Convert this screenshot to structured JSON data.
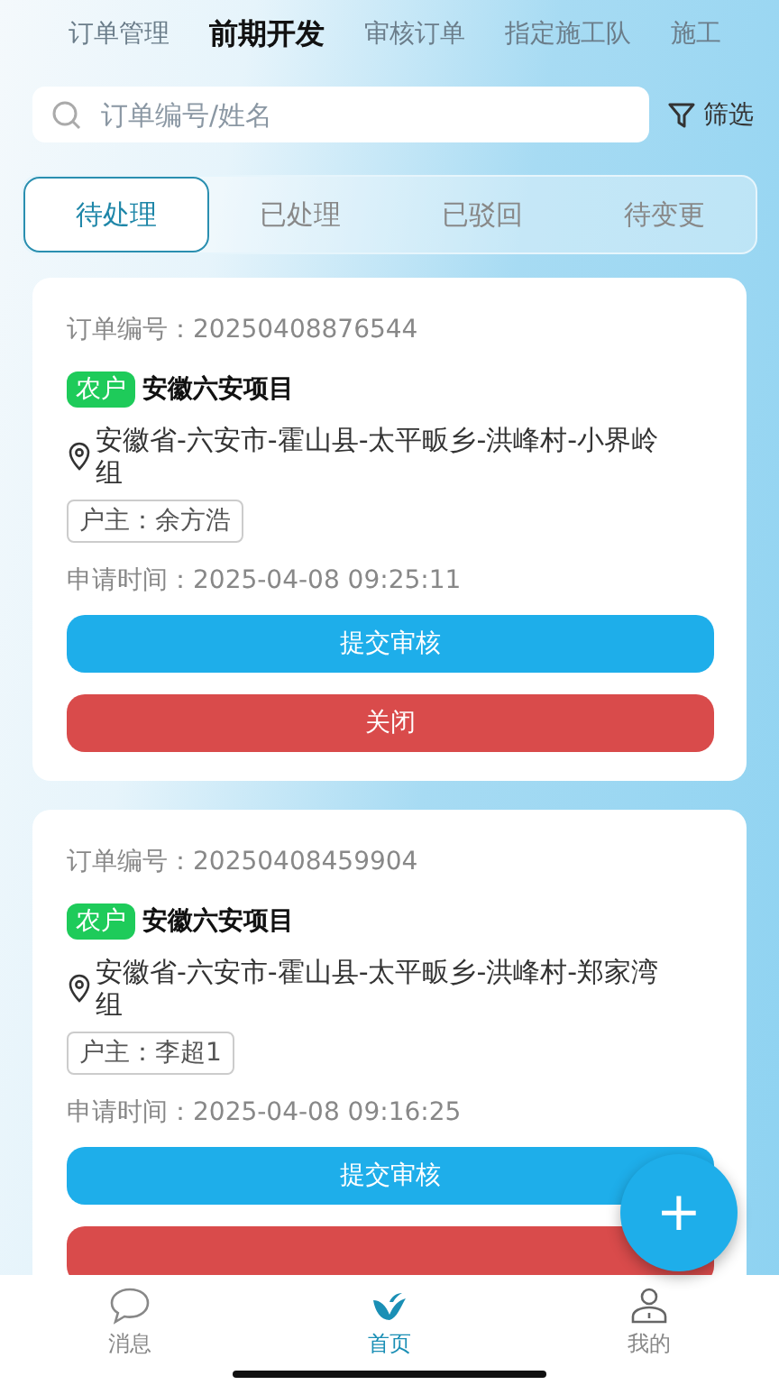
{
  "top_tabs": [
    {
      "label": "订单管理",
      "selected": false
    },
    {
      "label": "前期开发",
      "selected": true
    },
    {
      "label": "审核订单",
      "selected": false
    },
    {
      "label": "指定施工队",
      "selected": false
    },
    {
      "label": "施工",
      "selected": false
    }
  ],
  "search": {
    "placeholder": "订单编号/姓名"
  },
  "filter": {
    "label": "筛选"
  },
  "status_tabs": [
    {
      "label": "待处理",
      "selected": true
    },
    {
      "label": "已处理",
      "selected": false
    },
    {
      "label": "已驳回",
      "selected": false
    },
    {
      "label": "待变更",
      "selected": false
    }
  ],
  "orders": [
    {
      "order_no": "订单编号：20250408876544",
      "tag": "农户",
      "project": "安徽六安项目",
      "address": "安徽省-六安市-霍山县-太平畈乡-洪峰村-小界岭组",
      "owner": "户主：余方浩",
      "time": "申请时间：2025-04-08 09:25:11",
      "buttons": [
        {
          "kind": "submit",
          "label": "提交审核"
        },
        {
          "kind": "close",
          "label": "关闭"
        }
      ]
    },
    {
      "order_no": "订单编号：20250408459904",
      "tag": "农户",
      "project": "安徽六安项目",
      "address": "安徽省-六安市-霍山县-太平畈乡-洪峰村-郑家湾组",
      "owner": "户主：李超1",
      "time": "申请时间：2025-04-08 09:16:25",
      "buttons": [
        {
          "kind": "submit",
          "label": "提交审核"
        },
        {
          "kind": "close"
        }
      ]
    }
  ],
  "fab": {
    "label": "+"
  },
  "nav": [
    {
      "kind": "message",
      "label": "消息",
      "selected": false
    },
    {
      "kind": "home",
      "label": "首页",
      "selected": true
    },
    {
      "kind": "user",
      "label": "我的",
      "selected": false
    }
  ]
}
